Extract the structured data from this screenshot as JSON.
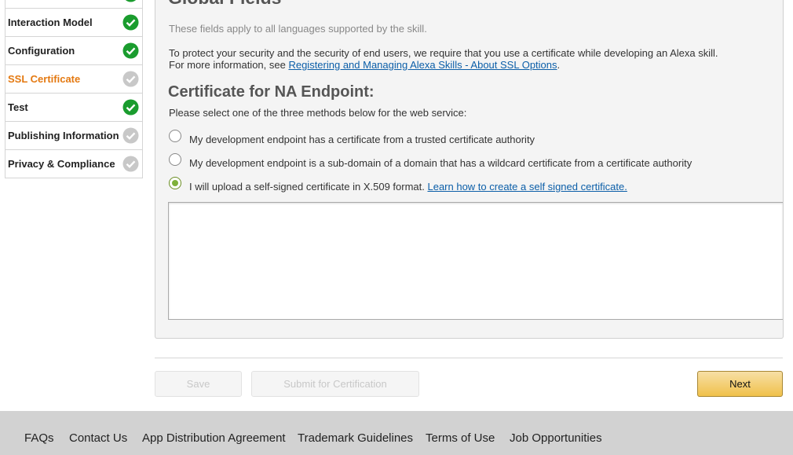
{
  "sidebar": {
    "items": [
      {
        "label": "",
        "status": "complete"
      },
      {
        "label": "Interaction Model",
        "status": "complete"
      },
      {
        "label": "Configuration",
        "status": "complete"
      },
      {
        "label": "SSL Certificate",
        "status": "incomplete",
        "active": true
      },
      {
        "label": "Test",
        "status": "complete"
      },
      {
        "label": "Publishing Information",
        "status": "incomplete"
      },
      {
        "label": "Privacy & Compliance",
        "status": "incomplete"
      }
    ],
    "icons": {
      "complete": "check-circle-green-icon",
      "incomplete": "check-circle-gray-icon"
    },
    "colors": {
      "complete": "#1a9c2e",
      "incomplete": "#c8c8c8",
      "active_label": "#e47911"
    }
  },
  "main": {
    "global_title": "Global Fields",
    "description": "These fields apply to all languages supported by the skill.",
    "security_text": "To protect your security and the security of end users, we require that you use a certificate while developing an Alexa skill.",
    "more_info_prefix": "For more information, see ",
    "more_info_link": "Registering and Managing Alexa Skills - About SSL Options",
    "more_info_suffix": ".",
    "cert_title": "Certificate for NA Endpoint:",
    "prompt": "Please select one of the three methods below for the web service:",
    "options": [
      {
        "label": "My development endpoint has a certificate from a trusted certificate authority",
        "selected": false
      },
      {
        "label": "My development endpoint is a sub-domain of a domain that has a wildcard certificate from a certificate authority",
        "selected": false
      },
      {
        "label": "I will upload a self-signed certificate in X.509 format. ",
        "link": "Learn how to create a self signed certificate.",
        "selected": true
      }
    ],
    "certificate_value": ""
  },
  "actions": {
    "save_label": "Save",
    "submit_label": "Submit for Certification",
    "next_label": "Next"
  },
  "footer": {
    "links": [
      "FAQs",
      "Contact Us",
      "App Distribution Agreement",
      "Trademark Guidelines",
      "Terms of Use",
      "Job Opportunities"
    ]
  }
}
